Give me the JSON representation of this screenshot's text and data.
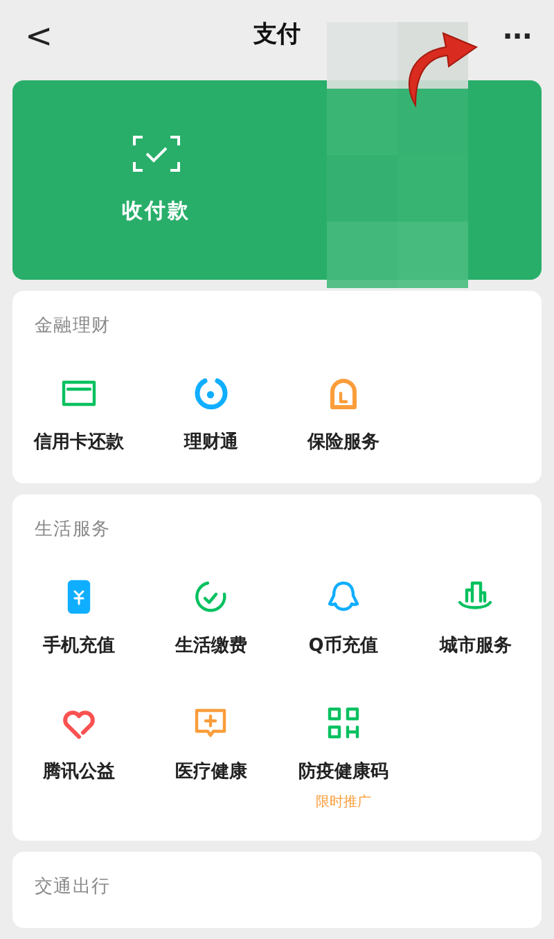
{
  "header": {
    "back": "<",
    "title": "支付",
    "more": "···"
  },
  "pay_card": {
    "label": "收付款"
  },
  "sections": [
    {
      "title": "金融理财",
      "items": [
        {
          "label": "信用卡还款"
        },
        {
          "label": "理财通"
        },
        {
          "label": "保险服务"
        }
      ]
    },
    {
      "title": "生活服务",
      "items": [
        {
          "label": "手机充值"
        },
        {
          "label": "生活缴费"
        },
        {
          "label": "Q币充值"
        },
        {
          "label": "城市服务"
        },
        {
          "label": "腾讯公益"
        },
        {
          "label": "医疗健康"
        },
        {
          "label": "防疫健康码",
          "badge": "限时推广"
        }
      ]
    },
    {
      "title": "交通出行"
    }
  ]
}
